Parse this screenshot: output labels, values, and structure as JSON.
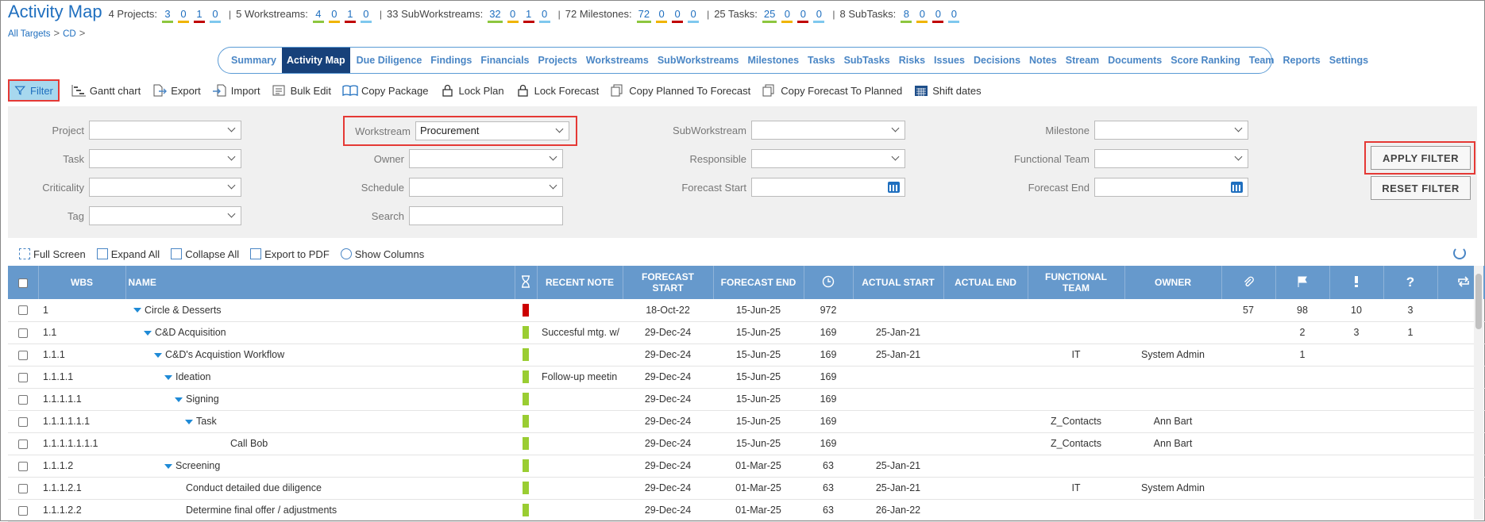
{
  "header": {
    "title": "Activity Map",
    "stats": [
      {
        "label": "4 Projects:",
        "values": [
          "3",
          "0",
          "1",
          "0"
        ]
      },
      {
        "label": "5 Workstreams:",
        "values": [
          "4",
          "0",
          "1",
          "0"
        ]
      },
      {
        "label": "33 SubWorkstreams:",
        "values": [
          "32",
          "0",
          "1",
          "0"
        ]
      },
      {
        "label": "72 Milestones:",
        "values": [
          "72",
          "0",
          "0",
          "0"
        ]
      },
      {
        "label": "25 Tasks:",
        "values": [
          "25",
          "0",
          "0",
          "0"
        ]
      },
      {
        "label": "8 SubTasks:",
        "values": [
          "8",
          "0",
          "0",
          "0"
        ]
      }
    ],
    "breadcrumb": [
      "All Targets",
      "CD"
    ]
  },
  "tabs": [
    "Summary",
    "Activity Map",
    "Due Diligence",
    "Findings",
    "Financials",
    "Projects",
    "Workstreams",
    "SubWorkstreams",
    "Milestones",
    "Tasks",
    "SubTasks",
    "Risks",
    "Issues",
    "Decisions",
    "Notes",
    "Stream",
    "Documents",
    "Score Ranking",
    "Team",
    "Reports",
    "Settings"
  ],
  "active_tab": "Activity Map",
  "toolbar": {
    "filter": "Filter",
    "gantt": "Gantt chart",
    "export": "Export",
    "import": "Import",
    "bulk_edit": "Bulk Edit",
    "copy_package": "Copy Package",
    "lock_plan": "Lock Plan",
    "lock_forecast": "Lock Forecast",
    "copy_p2f": "Copy Planned To Forecast",
    "copy_f2p": "Copy Forecast To Planned",
    "shift_dates": "Shift dates"
  },
  "filters": {
    "project": {
      "label": "Project",
      "value": ""
    },
    "task": {
      "label": "Task",
      "value": ""
    },
    "criticality": {
      "label": "Criticality",
      "value": ""
    },
    "tag": {
      "label": "Tag",
      "value": ""
    },
    "workstream": {
      "label": "Workstream",
      "value": "Procurement"
    },
    "owner": {
      "label": "Owner",
      "value": ""
    },
    "schedule": {
      "label": "Schedule",
      "value": ""
    },
    "search": {
      "label": "Search",
      "value": ""
    },
    "subworkstream": {
      "label": "SubWorkstream",
      "value": ""
    },
    "responsible": {
      "label": "Responsible",
      "value": ""
    },
    "forecast_start": {
      "label": "Forecast Start",
      "value": ""
    },
    "milestone": {
      "label": "Milestone",
      "value": ""
    },
    "functional_team": {
      "label": "Functional Team",
      "value": ""
    },
    "forecast_end": {
      "label": "Forecast End",
      "value": ""
    },
    "apply": "APPLY FILTER",
    "reset": "RESET FILTER"
  },
  "grid_toolbar": {
    "full_screen": "Full Screen",
    "expand_all": "Expand All",
    "collapse_all": "Collapse All",
    "export_pdf": "Export to PDF",
    "show_columns": "Show Columns"
  },
  "table": {
    "headers": {
      "wbs": "WBS",
      "name": "NAME",
      "recent_note": "RECENT NOTE",
      "forecast_start": "FORECAST START",
      "forecast_end": "FORECAST END",
      "actual_start": "ACTUAL START",
      "actual_end": "ACTUAL END",
      "functional_team": "FUNCTIONAL TEAM",
      "owner": "OWNER",
      "docs": "",
      "flags": "",
      "excl": "",
      "q": "",
      "sync": ""
    },
    "rows": [
      {
        "wbs": "1",
        "name": "Circle & Desserts",
        "indent": 0,
        "caret": true,
        "status": "#cc0000",
        "note": "",
        "fs": "18-Oct-22",
        "fe": "15-Jun-25",
        "dur": "972",
        "as": "",
        "ae": "",
        "team": "",
        "owner": "",
        "docs": "57",
        "flags": "98",
        "excl": "10",
        "q": "3"
      },
      {
        "wbs": "1.1",
        "name": "C&D Acquisition",
        "indent": 1,
        "caret": true,
        "status": "#9acd32",
        "note": "Succesful mtg. w/",
        "fs": "29-Dec-24",
        "fe": "15-Jun-25",
        "dur": "169",
        "as": "25-Jan-21",
        "ae": "",
        "team": "",
        "owner": "",
        "docs": "",
        "flags": "2",
        "excl": "3",
        "q": "1"
      },
      {
        "wbs": "1.1.1",
        "name": "C&D's Acquistion Workflow",
        "indent": 2,
        "caret": true,
        "status": "#9acd32",
        "note": "",
        "fs": "29-Dec-24",
        "fe": "15-Jun-25",
        "dur": "169",
        "as": "25-Jan-21",
        "ae": "",
        "team": "IT",
        "owner": "System Admin",
        "docs": "",
        "flags": "1",
        "excl": "",
        "q": ""
      },
      {
        "wbs": "1.1.1.1",
        "name": "Ideation",
        "indent": 3,
        "caret": true,
        "status": "#9acd32",
        "note": "Follow-up meetin",
        "fs": "29-Dec-24",
        "fe": "15-Jun-25",
        "dur": "169",
        "as": "",
        "ae": "",
        "team": "",
        "owner": "",
        "docs": "",
        "flags": "",
        "excl": "",
        "q": ""
      },
      {
        "wbs": "1.1.1.1.1",
        "name": "Signing",
        "indent": 4,
        "caret": true,
        "status": "#9acd32",
        "note": "",
        "fs": "29-Dec-24",
        "fe": "15-Jun-25",
        "dur": "169",
        "as": "",
        "ae": "",
        "team": "",
        "owner": "",
        "docs": "",
        "flags": "",
        "excl": "",
        "q": ""
      },
      {
        "wbs": "1.1.1.1.1.1",
        "name": "Task",
        "indent": 5,
        "caret": true,
        "status": "#9acd32",
        "note": "",
        "fs": "29-Dec-24",
        "fe": "15-Jun-25",
        "dur": "169",
        "as": "",
        "ae": "",
        "team": "Z_Contacts",
        "owner": "Ann Bart",
        "docs": "",
        "flags": "",
        "excl": "",
        "q": ""
      },
      {
        "wbs": "1.1.1.1.1.1.1",
        "name": "Call Bob",
        "indent": 6,
        "caret": false,
        "status": "#9acd32",
        "note": "",
        "fs": "29-Dec-24",
        "fe": "15-Jun-25",
        "dur": "169",
        "as": "",
        "ae": "",
        "team": "Z_Contacts",
        "owner": "Ann Bart",
        "docs": "",
        "flags": "",
        "excl": "",
        "q": ""
      },
      {
        "wbs": "1.1.1.2",
        "name": "Screening",
        "indent": 3,
        "caret": true,
        "status": "#9acd32",
        "note": "",
        "fs": "29-Dec-24",
        "fe": "01-Mar-25",
        "dur": "63",
        "as": "25-Jan-21",
        "ae": "",
        "team": "",
        "owner": "",
        "docs": "",
        "flags": "",
        "excl": "",
        "q": ""
      },
      {
        "wbs": "1.1.1.2.1",
        "name": "Conduct detailed due diligence",
        "indent": 4,
        "caret": false,
        "status": "#9acd32",
        "note": "",
        "fs": "29-Dec-24",
        "fe": "01-Mar-25",
        "dur": "63",
        "as": "25-Jan-21",
        "ae": "",
        "team": "IT",
        "owner": "System Admin",
        "docs": "",
        "flags": "",
        "excl": "",
        "q": ""
      },
      {
        "wbs": "1.1.1.2.2",
        "name": "Determine final offer / adjustments",
        "indent": 4,
        "caret": false,
        "status": "#9acd32",
        "note": "",
        "fs": "29-Dec-24",
        "fe": "01-Mar-25",
        "dur": "63",
        "as": "26-Jan-22",
        "ae": "",
        "team": "",
        "owner": "",
        "docs": "",
        "flags": "",
        "excl": "",
        "q": ""
      }
    ]
  }
}
